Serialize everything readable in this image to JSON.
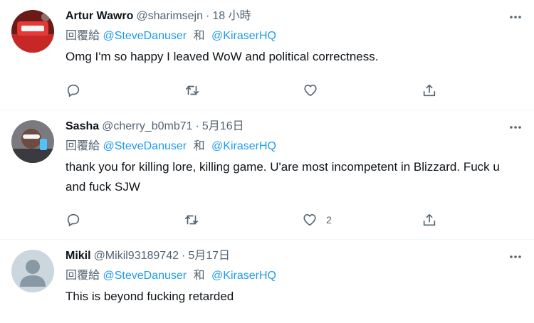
{
  "tweets": [
    {
      "display_name": "Artur Wawro",
      "handle": "@sharimsejn",
      "separator": "·",
      "time": "18 小時",
      "reply_prefix": "回覆給",
      "mention_1": "@SteveDanuser",
      "conj": "和",
      "mention_2": "@KiraserHQ",
      "text": "Omg I'm so happy I leaved WoW and political correctness.",
      "like_count": ""
    },
    {
      "display_name": "Sasha",
      "handle": "@cherry_b0mb71",
      "separator": "·",
      "time": "5月16日",
      "reply_prefix": "回覆給",
      "mention_1": "@SteveDanuser",
      "conj": "和",
      "mention_2": "@KiraserHQ",
      "text": "thank you for killing lore, killing game. U'are most incompetent in Blizzard. Fuck u and fuck SJW",
      "like_count": "2"
    },
    {
      "display_name": "Mikil",
      "handle": "@Mikil93189742",
      "separator": "·",
      "time": "5月17日",
      "reply_prefix": "回覆給",
      "mention_1": "@SteveDanuser",
      "conj": "和",
      "mention_2": "@KiraserHQ",
      "text": "This is beyond fucking retarded"
    }
  ],
  "icons": {
    "more": "more-icon",
    "reply": "reply-icon",
    "retweet": "retweet-icon",
    "like": "heart-icon",
    "share": "share-icon"
  },
  "colors": {
    "link": "#1d9bf0",
    "secondary_text": "#536471",
    "divider": "#eff3f4"
  }
}
